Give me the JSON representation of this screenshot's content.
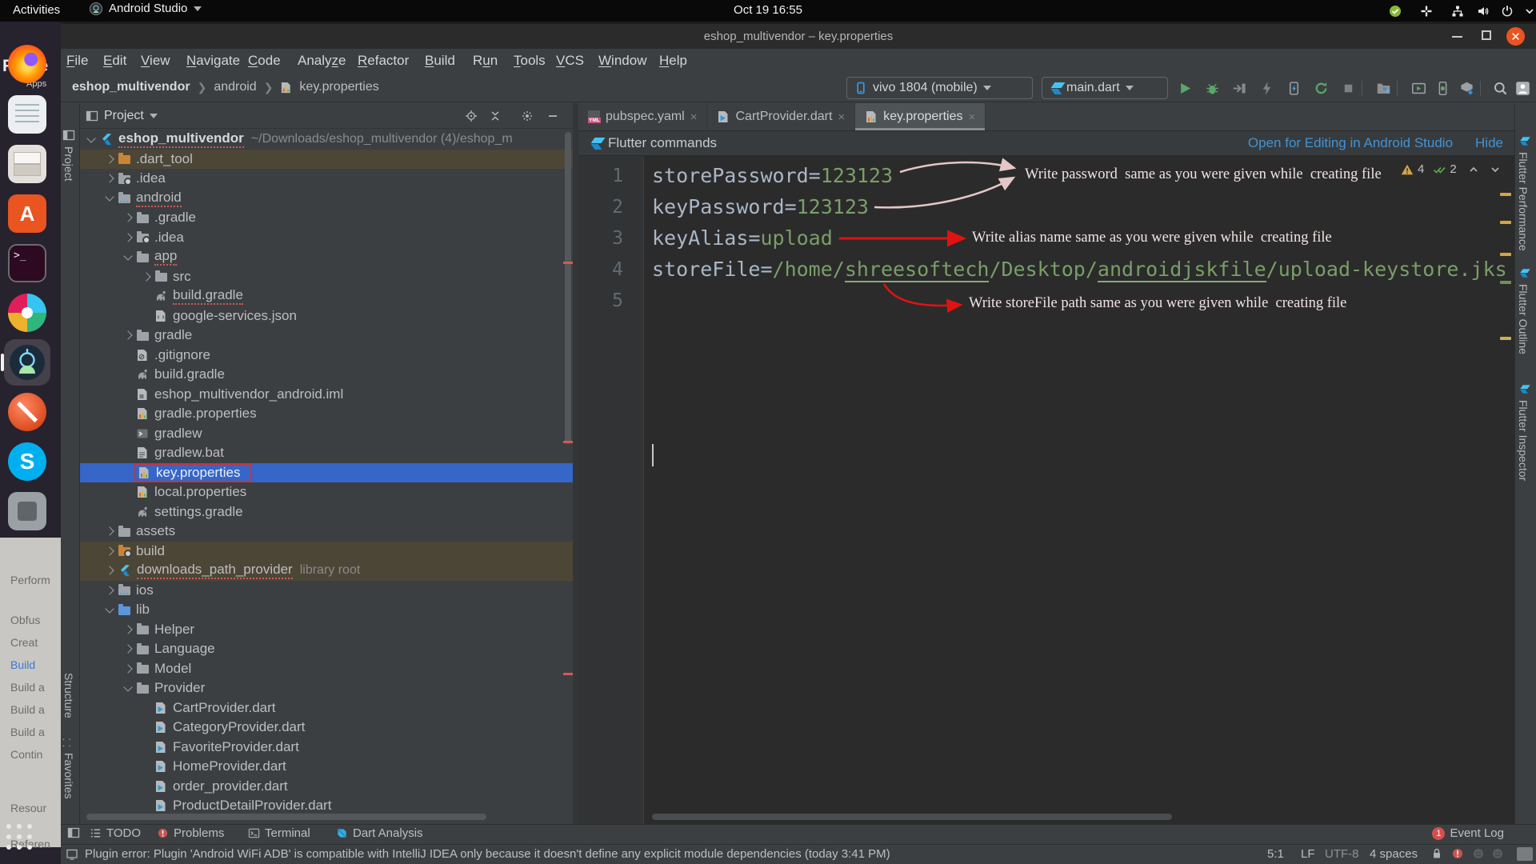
{
  "ubuntu_bar": {
    "activities": "Activities",
    "app_menu": "Android Studio",
    "clock": "Oct 19 16:55",
    "tray_icons": [
      "verified",
      "slack",
      "network",
      "volume",
      "power",
      "chevron"
    ]
  },
  "background": {
    "window_title_fragment": "Flutte",
    "apps_fragment": "Apps",
    "sidebar_fragments": [
      {
        "t": "Perform"
      },
      {
        "t": "Obfus"
      },
      {
        "t": "Creat"
      },
      {
        "t": "Build",
        "blue": true
      },
      {
        "t": "Build a"
      },
      {
        "t": "Build a"
      },
      {
        "t": "Build a"
      },
      {
        "t": "Contin"
      },
      {
        "t": "Resour"
      },
      {
        "t": "Referen"
      }
    ]
  },
  "dock": {
    "icons": [
      "firefox",
      "document",
      "cabinet",
      "ubuntu",
      "terminal",
      "colorful",
      "androidstudio",
      "orangeapp",
      "skype",
      "grayapp"
    ],
    "active_icon": "androidstudio",
    "ubuntu_letter": "A",
    "terminal_glyph": ">_",
    "skype_letter": "S"
  },
  "window": {
    "title": "eshop_multivendor – key.properties"
  },
  "menu_bar": [
    "File",
    "Edit",
    "View",
    "Navigate",
    "Code",
    "Analyze",
    "Refactor",
    "Build",
    "Run",
    "Tools",
    "VCS",
    "Window",
    "Help"
  ],
  "toolbar": {
    "breadcrumb": [
      "eshop_multivendor",
      "android",
      "key.properties"
    ],
    "device_selector": "vivo 1804 (mobile)",
    "run_config": "main.dart",
    "icons": [
      "run",
      "debug",
      "attach",
      "profiler",
      "hot-reload",
      "hot-restart",
      "stop",
      "folder-run",
      "run-window",
      "device-manager",
      "sdk-manager",
      "search",
      "avatar"
    ]
  },
  "left_strip": {
    "top": "Project",
    "mid": "Structure",
    "bottom": "Favorites"
  },
  "right_strip": [
    "Flutter Performance",
    "Flutter Outline",
    "Flutter Inspector"
  ],
  "project_panel": {
    "header": "Project",
    "tree": [
      {
        "lvl": 0,
        "a": "d",
        "ic": "flutter",
        "t": "eshop_multivendor",
        "b": 1,
        "sq": 1,
        "x": "~/Downloads/eshop_multivendor (4)/eshop_m"
      },
      {
        "lvl": 1,
        "a": "r",
        "ic": "folder-or",
        "t": ".dart_tool",
        "bg": 1
      },
      {
        "lvl": 1,
        "a": "r",
        "ic": "folder-gear",
        "t": ".idea"
      },
      {
        "lvl": 1,
        "a": "d",
        "ic": "folder-mod",
        "t": "android",
        "sq": 1
      },
      {
        "lvl": 2,
        "a": "r",
        "ic": "folder",
        "t": ".gradle"
      },
      {
        "lvl": 2,
        "a": "r",
        "ic": "folder-gear",
        "t": ".idea"
      },
      {
        "lvl": 2,
        "a": "d",
        "ic": "folder",
        "t": "app",
        "sq": 1
      },
      {
        "lvl": 3,
        "a": "r",
        "ic": "folder",
        "t": "src"
      },
      {
        "lvl": 3,
        "ic": "gradle",
        "t": "build.gradle",
        "sq": 1
      },
      {
        "lvl": 3,
        "ic": "json",
        "t": "google-services.json"
      },
      {
        "lvl": 2,
        "a": "r",
        "ic": "folder",
        "t": "gradle"
      },
      {
        "lvl": 2,
        "ic": "gitignore",
        "t": ".gitignore"
      },
      {
        "lvl": 2,
        "ic": "gradle",
        "t": "build.gradle"
      },
      {
        "lvl": 2,
        "ic": "iml",
        "t": "eshop_multivendor_android.iml"
      },
      {
        "lvl": 2,
        "ic": "props",
        "t": "gradle.properties"
      },
      {
        "lvl": 2,
        "ic": "gradlew",
        "t": "gradlew"
      },
      {
        "lvl": 2,
        "ic": "bat",
        "t": "gradlew.bat"
      },
      {
        "lvl": 2,
        "ic": "props",
        "t": "key.properties",
        "sel": 1,
        "box": 1
      },
      {
        "lvl": 2,
        "ic": "props",
        "t": "local.properties"
      },
      {
        "lvl": 2,
        "ic": "gradle",
        "t": "settings.gradle"
      },
      {
        "lvl": 1,
        "a": "r",
        "ic": "folder",
        "t": "assets"
      },
      {
        "lvl": 1,
        "a": "r",
        "ic": "folder-gear-or",
        "t": "build",
        "bg": 1
      },
      {
        "lvl": 1,
        "a": "r",
        "ic": "flutter",
        "t": "downloads_path_provider",
        "x": "library root",
        "bg": 1,
        "sq": 1
      },
      {
        "lvl": 1,
        "a": "r",
        "ic": "folder-mod",
        "t": "ios"
      },
      {
        "lvl": 1,
        "a": "d",
        "ic": "folder-bl",
        "t": "lib"
      },
      {
        "lvl": 2,
        "a": "r",
        "ic": "folder",
        "t": "Helper"
      },
      {
        "lvl": 2,
        "a": "r",
        "ic": "folder",
        "t": "Language"
      },
      {
        "lvl": 2,
        "a": "r",
        "ic": "folder",
        "t": "Model"
      },
      {
        "lvl": 2,
        "a": "d",
        "ic": "folder",
        "t": "Provider"
      },
      {
        "lvl": 3,
        "ic": "dart",
        "t": "CartProvider.dart"
      },
      {
        "lvl": 3,
        "ic": "dart",
        "t": "CategoryProvider.dart"
      },
      {
        "lvl": 3,
        "ic": "dart",
        "t": "FavoriteProvider.dart"
      },
      {
        "lvl": 3,
        "ic": "dart",
        "t": "HomeProvider.dart"
      },
      {
        "lvl": 3,
        "ic": "dart",
        "t": "order_provider.dart"
      },
      {
        "lvl": 3,
        "ic": "dart",
        "t": "ProductDetailProvider.dart"
      }
    ]
  },
  "editor": {
    "tabs": [
      {
        "label": "pubspec.yaml",
        "icon": "yml"
      },
      {
        "label": "CartProvider.dart",
        "icon": "dart"
      },
      {
        "label": "key.properties",
        "icon": "props",
        "active": true
      }
    ],
    "banner": {
      "text": "Flutter commands",
      "link": "Open for Editing in Android Studio",
      "hide": "Hide"
    },
    "lines": [
      {
        "n": "1",
        "code": [
          {
            "t": "storePassword=",
            "c": "k"
          },
          {
            "t": "123123",
            "c": "v"
          }
        ]
      },
      {
        "n": "2",
        "code": [
          {
            "t": "keyPassword=",
            "c": "k"
          },
          {
            "t": "123123",
            "c": "v"
          }
        ]
      },
      {
        "n": "3",
        "code": [
          {
            "t": "keyAlias=",
            "c": "k"
          },
          {
            "t": "upload",
            "c": "v"
          }
        ]
      },
      {
        "n": "4",
        "code": [
          {
            "t": "storeFile=",
            "c": "k"
          },
          {
            "t": "/home/",
            "c": "v"
          },
          {
            "t": "shreesoftech",
            "c": "v u"
          },
          {
            "t": "/Desktop/",
            "c": "v"
          },
          {
            "t": "androidjskfile",
            "c": "v u"
          },
          {
            "t": "/upload-keystore.jks",
            "c": "v"
          }
        ]
      },
      {
        "n": "5",
        "code": []
      }
    ],
    "inspections": {
      "warnings_count": "4",
      "typos_count": "2"
    }
  },
  "annotations": [
    {
      "text": "Write password  same as you were given while  creating file"
    },
    {
      "text": "Write alias name same as you were given while  creating file"
    },
    {
      "text": "Write storeFile path same as you were given while  creating file"
    }
  ],
  "bottom_bar": {
    "left": [
      {
        "label": "TODO",
        "icon": "todo"
      },
      {
        "label": "Problems",
        "icon": "problems"
      },
      {
        "label": "Terminal",
        "icon": "terminalb"
      },
      {
        "label": "Dart Analysis",
        "icon": "dartb"
      }
    ],
    "event_log": {
      "badge": "1",
      "label": "Event Log"
    }
  },
  "status_bar": {
    "message": "Plugin error: Plugin 'Android WiFi ADB' is compatible with IntelliJ IDEA only because it doesn't define any explicit module dependencies (today 3:41 PM)",
    "caret": "5:1",
    "line_ending": "LF",
    "encoding": "UTF-8",
    "indent": "4 spaces"
  },
  "colors": {
    "selection_blue": "#3566c8",
    "excluded_olive": "#4c4637",
    "link_blue": "#4193d5",
    "value_green": "#7a9e68",
    "key_gray": "#a9b7c6",
    "annotation_red": "#e11212",
    "annotation_pink": "#e5c6c6",
    "close_orange": "#ea5420",
    "warning_yellow": "#d9a343"
  }
}
